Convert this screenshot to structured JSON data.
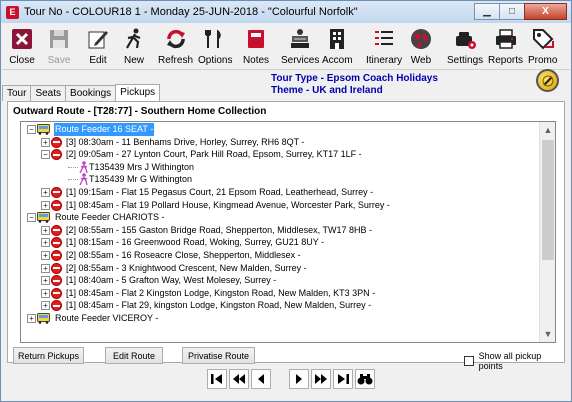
{
  "window": {
    "app_icon": "E",
    "title": "Tour No - COLOUR18 1 - Monday 25-JUN-2018 - \"Colourful Norfolk\"",
    "minimize_glyph": "▁",
    "maximize_glyph": "□",
    "close_glyph": "X"
  },
  "toolbar": [
    {
      "key": "close",
      "label": "Close",
      "icon": "close-icon",
      "enabled": true
    },
    {
      "key": "save",
      "label": "Save",
      "icon": "save-icon",
      "enabled": false
    },
    {
      "key": "edit",
      "label": "Edit",
      "icon": "edit-icon",
      "enabled": true
    },
    {
      "key": "new",
      "label": "New",
      "icon": "new-walker-icon",
      "enabled": true
    },
    {
      "key": "refresh",
      "label": "Refresh",
      "icon": "refresh-icon",
      "enabled": true
    },
    {
      "key": "options",
      "label": "Options",
      "icon": "options-icon",
      "enabled": true
    },
    {
      "key": "notes",
      "label": "Notes",
      "icon": "notes-icon",
      "enabled": true
    },
    {
      "key": "services",
      "label": "Services",
      "icon": "services-icon",
      "enabled": true
    },
    {
      "key": "accom",
      "label": "Accom",
      "icon": "building-icon",
      "enabled": true
    },
    {
      "key": "itinerary",
      "label": "Itinerary",
      "icon": "itinerary-icon",
      "enabled": true
    },
    {
      "key": "web",
      "label": "Web",
      "icon": "globe-icon",
      "enabled": true
    },
    {
      "key": "settings",
      "label": "Settings",
      "icon": "settings-icon",
      "enabled": true
    },
    {
      "key": "reports",
      "label": "Reports",
      "icon": "printer-icon",
      "enabled": true
    },
    {
      "key": "promo",
      "label": "Promo",
      "icon": "tag-icon",
      "enabled": true
    }
  ],
  "tour_info": {
    "line1": "Tour Type - Epsom Coach Holidays",
    "line2": "Theme - UK and Ireland"
  },
  "tabs": [
    {
      "label": "Tour",
      "active": false
    },
    {
      "label": "Seats",
      "active": false
    },
    {
      "label": "Bookings",
      "active": false
    },
    {
      "label": "Pickups",
      "active": true
    }
  ],
  "route_heading": "Outward Route - [T28:77] - Southern Home Collection",
  "tree": [
    {
      "level": 0,
      "type": "feeder",
      "expander": "−",
      "text": "Route Feeder 16 SEAT -",
      "selected": true
    },
    {
      "level": 1,
      "type": "stop",
      "expander": "+",
      "text": "[3] 08:30am - 11 Benhams Drive, Horley, Surrey, RH6 8QT -"
    },
    {
      "level": 1,
      "type": "stop",
      "expander": "−",
      "text": "[2] 09:05am - 27 Lynton Court, Park Hill Road, Epsom, Surrey, KT17 1LF -"
    },
    {
      "level": 2,
      "type": "pax",
      "expander": "",
      "text": "T135439 Mrs J Withington"
    },
    {
      "level": 2,
      "type": "pax",
      "expander": "",
      "text": "T135439 Mr G Withington"
    },
    {
      "level": 1,
      "type": "stop",
      "expander": "+",
      "text": "[1] 09:15am - Flat 15 Pegasus Court, 21 Epsom Road, Leatherhead, Surrey -"
    },
    {
      "level": 1,
      "type": "stop",
      "expander": "+",
      "text": "[1] 08:45am - Flat 19 Pollard House, Kingmead Avenue, Worcester Park, Surrey -"
    },
    {
      "level": 0,
      "type": "feeder",
      "expander": "−",
      "text": "Route Feeder CHARIOTS -"
    },
    {
      "level": 1,
      "type": "stop",
      "expander": "+",
      "text": "[2] 08:55am - 155 Gaston Bridge Road, Shepperton, Middlesex, TW17 8HB -"
    },
    {
      "level": 1,
      "type": "stop",
      "expander": "+",
      "text": "[1] 08:15am - 16 Greenwood Road, Woking, Surrey, GU21 8UY -"
    },
    {
      "level": 1,
      "type": "stop",
      "expander": "+",
      "text": "[2] 08:55am - 16 Roseacre Close, Shepperton, Middlesex -"
    },
    {
      "level": 1,
      "type": "stop",
      "expander": "+",
      "text": "[2] 08:55am - 3 Knightwood Crescent, New Malden, Surrey -"
    },
    {
      "level": 1,
      "type": "stop",
      "expander": "+",
      "text": "[1] 08:40am - 5 Grafton Way, West Molesey, Surrey -"
    },
    {
      "level": 1,
      "type": "stop",
      "expander": "+",
      "text": "[1] 08:45am - Flat 2 Kingston Lodge, Kingston Road, New Malden, KT3 3PN -"
    },
    {
      "level": 1,
      "type": "stop",
      "expander": "+",
      "text": "[1] 08:45am - Flat 29, kingston Lodge, Kingston Road, New Malden, Surrey -"
    },
    {
      "level": 0,
      "type": "feeder",
      "expander": "+",
      "text": "Route Feeder VICEROY -"
    }
  ],
  "buttons": {
    "return_pickups": "Return Pickups",
    "edit_route": "Edit Route",
    "privatise_route": "Privatise Route"
  },
  "show_all_pickup_points": {
    "label": "Show all pickup points",
    "checked": false
  },
  "nav": {
    "first": "|◀",
    "prev_page": "◀◀",
    "prev": "◀",
    "next": "▶",
    "next_page": "▶▶",
    "last": "▶|",
    "find_icon": "binoculars-icon"
  },
  "colors": {
    "selection": "#3399ff",
    "info_text": "#0000b0",
    "stop_red": "#e02020"
  }
}
